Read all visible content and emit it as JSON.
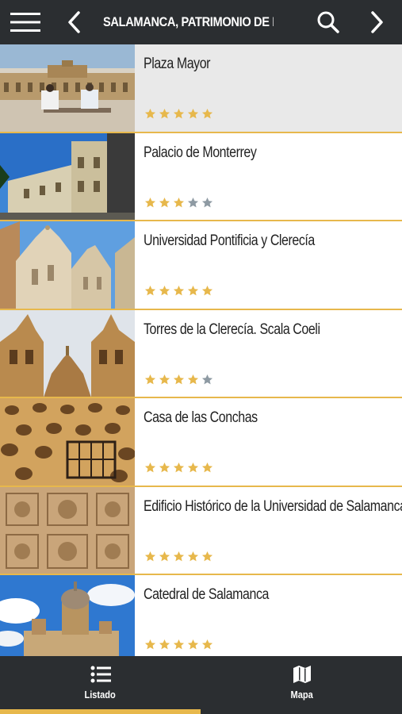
{
  "header": {
    "title": "SALAMANCA, PATRIMONIO DE LA HUMANIDAD",
    "icons": [
      "hamburger-menu-icon",
      "chevron-left-icon",
      "search-icon",
      "chevron-right-icon"
    ]
  },
  "places": [
    {
      "name": "Plaza Mayor",
      "rating": 5,
      "selected": true
    },
    {
      "name": "Palacio de Monterrey",
      "rating": 3,
      "selected": false
    },
    {
      "name": "Universidad Pontificia y Clerecía",
      "rating": 5,
      "selected": false
    },
    {
      "name": "Torres de la Clerecía. Scala Coeli",
      "rating": 4,
      "selected": false
    },
    {
      "name": "Casa de las Conchas",
      "rating": 5,
      "selected": false
    },
    {
      "name": "Edificio Histórico de la Universidad de Salamanca",
      "rating": 5,
      "selected": false
    },
    {
      "name": "Catedral de Salamanca",
      "rating": 5,
      "selected": false
    }
  ],
  "rating_max": 5,
  "tabs": [
    {
      "label": "Listado",
      "icon": "list-icon",
      "active": true
    },
    {
      "label": "Mapa",
      "icon": "map-icon",
      "active": false
    }
  ],
  "colors": {
    "bar": "#2b2e31",
    "accent": "#e7b84c",
    "star_on": "#e7b84c",
    "star_off": "#8e9aa3",
    "selected_row": "#e9e9e9"
  }
}
